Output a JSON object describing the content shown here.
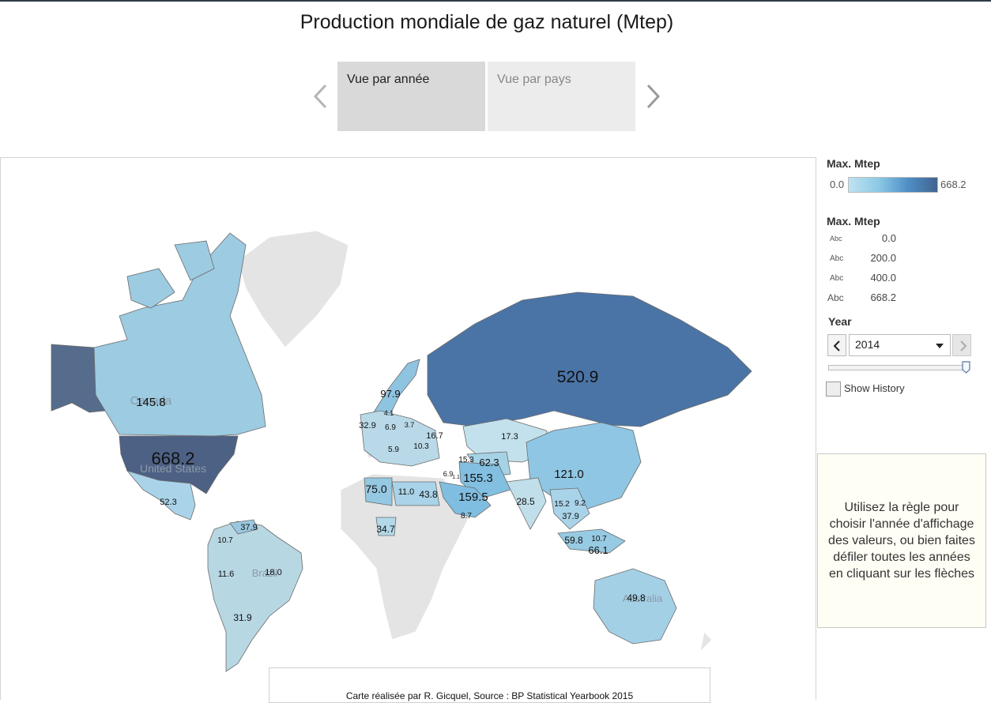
{
  "title": "Production mondiale de gaz naturel (Mtep)",
  "tabs": [
    {
      "label": "Vue par année",
      "active": true
    },
    {
      "label": "Vue par pays",
      "active": false
    }
  ],
  "icons": {
    "prev": "chevron-left-icon",
    "next": "chevron-right-icon"
  },
  "colors": {
    "scale_min": "#bfe3f0",
    "scale_max": "#41648f",
    "no_data": "#e4e4e4"
  },
  "legend": {
    "color_title": "Max. Mtep",
    "color_min": "0.0",
    "color_max": "668.2",
    "size_title": "Max. Mtep",
    "size_symbol": "Abc",
    "size_items": [
      "0.0",
      "200.0",
      "400.0",
      "668.2"
    ]
  },
  "year_filter": {
    "label": "Year",
    "value": "2014",
    "show_history_label": "Show History",
    "show_history_checked": false
  },
  "note": "Utilisez la règle pour choisir l'année d'affichage des valeurs, ou bien faites défiler toutes les années en cliquant sur les flèches",
  "credit": "Carte réalisée par R. Gicquel,    Source : BP Statistical Yearbook 2015",
  "map": {
    "visible_country_names": [
      "Canada",
      "United States",
      "Brazil",
      "Australia"
    ],
    "values": [
      {
        "id": "usa",
        "label": "668.2",
        "value": 668.2
      },
      {
        "id": "russia",
        "label": "520.9",
        "value": 520.9
      },
      {
        "id": "iran",
        "label": "155.3",
        "value": 155.3
      },
      {
        "id": "qatar",
        "label": "159.5",
        "value": 159.5
      },
      {
        "id": "canada",
        "label": "145.8",
        "value": 145.8
      },
      {
        "id": "china",
        "label": "121.0",
        "value": 121.0
      },
      {
        "id": "norway",
        "label": "97.9",
        "value": 97.9
      },
      {
        "id": "algeria",
        "label": "75.0",
        "value": 75.0
      },
      {
        "id": "indonesia",
        "label": "66.1",
        "value": 66.1
      },
      {
        "id": "turkmenistan",
        "label": "62.3",
        "value": 62.3
      },
      {
        "id": "malaysia",
        "label": "59.8",
        "value": 59.8
      },
      {
        "id": "mexico",
        "label": "52.3",
        "value": 52.3
      },
      {
        "id": "australia",
        "label": "49.8",
        "value": 49.8
      },
      {
        "id": "egypt",
        "label": "43.8",
        "value": 43.8
      },
      {
        "id": "trinidad",
        "label": "37.9",
        "value": 37.9
      },
      {
        "id": "thailand",
        "label": "37.9",
        "value": 37.9
      },
      {
        "id": "nigeria",
        "label": "34.7",
        "value": 34.7
      },
      {
        "id": "netherlands",
        "label": "32.9",
        "value": 32.9
      },
      {
        "id": "argentina",
        "label": "31.9",
        "value": 31.9
      },
      {
        "id": "india",
        "label": "28.5",
        "value": 28.5
      },
      {
        "id": "brazil",
        "label": "18.0",
        "value": 18.0
      },
      {
        "id": "kazakhstan",
        "label": "17.3",
        "value": 17.3
      },
      {
        "id": "ukraine",
        "label": "16.7",
        "value": 16.7
      },
      {
        "id": "azerbaijan",
        "label": "15.3",
        "value": 15.3
      },
      {
        "id": "myanmar",
        "label": "15.2",
        "value": 15.2
      },
      {
        "id": "peru",
        "label": "11.6",
        "value": 11.6
      },
      {
        "id": "libya",
        "label": "11.0",
        "value": 11.0
      },
      {
        "id": "colombia",
        "label": "10.7",
        "value": 10.7
      },
      {
        "id": "brunei",
        "label": "10.7",
        "value": 10.7
      },
      {
        "id": "romania",
        "label": "10.3",
        "value": 10.3
      },
      {
        "id": "vietnam",
        "label": "9.2",
        "value": 9.2
      },
      {
        "id": "israel",
        "label": "6.9",
        "value": 6.9
      },
      {
        "id": "germany",
        "label": "6.9",
        "value": 6.9
      },
      {
        "id": "yemen",
        "label": "8.7",
        "value": 8.7
      },
      {
        "id": "italy",
        "label": "5.9",
        "value": 5.9
      },
      {
        "id": "denmark",
        "label": "4.1",
        "value": 4.1
      },
      {
        "id": "poland",
        "label": "3.7",
        "value": 3.7
      },
      {
        "id": "syria",
        "label": "1.1",
        "value": 1.1
      }
    ]
  }
}
